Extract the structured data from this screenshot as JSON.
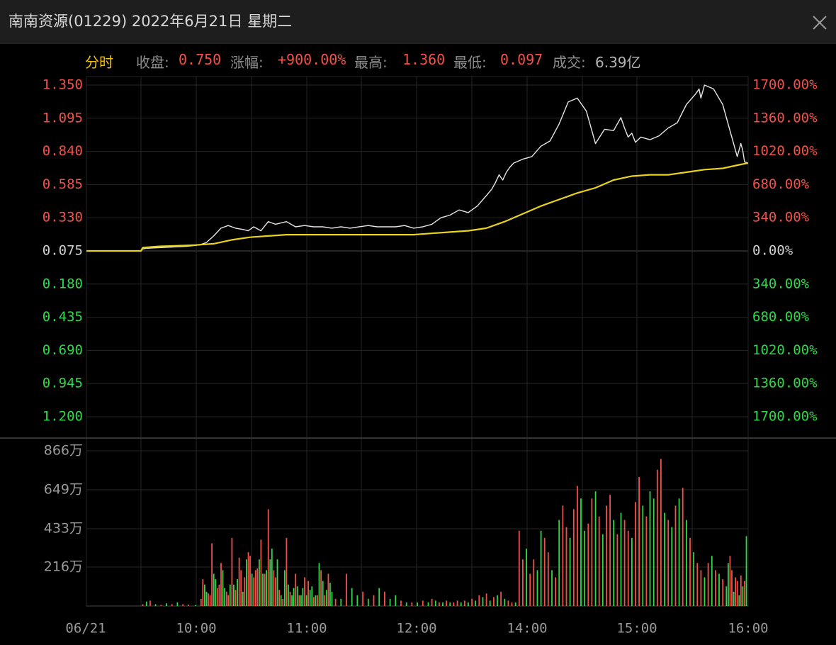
{
  "window": {
    "title": "南南资源(01229) 2022年6月21日 星期二",
    "close_icon": "close-icon"
  },
  "info": {
    "mode_label": "分时",
    "close_label": "收盘:",
    "close_value": "0.750",
    "change_label": "涨幅:",
    "change_value": "+900.00%",
    "high_label": "最高:",
    "high_value": "1.360",
    "low_label": "最低:",
    "low_value": "0.097",
    "volume_label": "成交:",
    "volume_value": "6.39亿"
  },
  "colors": {
    "background": "#000000",
    "grid": "#262626",
    "price_line": "#e6e6e6",
    "avg_line": "#e8d21c",
    "up": "#f0524a",
    "down": "#2fd84a",
    "axis_text": "#9a9a9a",
    "accent": "#f2c100"
  },
  "chart_data": {
    "type": "line",
    "reference_price": 0.075,
    "x_ticks": [
      "06/21",
      "10:00",
      "11:00",
      "12:00",
      "14:00",
      "15:00",
      "16:00"
    ],
    "y_left_ticks_up": [
      "1.350",
      "1.095",
      "0.840",
      "0.585",
      "0.330"
    ],
    "y_left_mid": "0.075",
    "y_left_ticks_down": [
      "0.180",
      "0.435",
      "0.690",
      "0.945",
      "1.200"
    ],
    "y_right_ticks_up": [
      "1700.00%",
      "1360.00%",
      "1020.00%",
      "680.00%",
      "340.00%"
    ],
    "y_right_mid": "0.00%",
    "y_right_ticks_down": [
      "340.00%",
      "680.00%",
      "1020.00%",
      "1360.00%",
      "1700.00%"
    ],
    "ylim_price": [
      0.075,
      1.35
    ],
    "volume_ticks": [
      "866万",
      "649万",
      "433万",
      "216万"
    ],
    "volume_max": 866,
    "series": [
      {
        "x": [
          0,
          15,
          30,
          31,
          33,
          40,
          47,
          55,
          62,
          66,
          70,
          74,
          78,
          82,
          86,
          89,
          92,
          96,
          100,
          104,
          110,
          115,
          120,
          125,
          130,
          135,
          140,
          145,
          150,
          155,
          160,
          165,
          170,
          175,
          180,
          185,
          190,
          195,
          200,
          205,
          210,
          215,
          220,
          223,
          225,
          227,
          229,
          231,
          233,
          235,
          240,
          245,
          250,
          255,
          260,
          265,
          270,
          275,
          280,
          285,
          290,
          294,
          296,
          298,
          300,
          302,
          305,
          310,
          315,
          320,
          325,
          330,
          335,
          336,
          337,
          338,
          340,
          345,
          350,
          355,
          358,
          360,
          361,
          362,
          364
        ],
        "values": [
          0.075,
          0.075,
          0.075,
          0.09,
          0.095,
          0.1,
          0.105,
          0.11,
          0.12,
          0.14,
          0.19,
          0.25,
          0.27,
          0.25,
          0.24,
          0.23,
          0.26,
          0.23,
          0.3,
          0.28,
          0.3,
          0.26,
          0.27,
          0.26,
          0.26,
          0.25,
          0.26,
          0.25,
          0.26,
          0.27,
          0.26,
          0.26,
          0.26,
          0.27,
          0.25,
          0.26,
          0.28,
          0.33,
          0.35,
          0.39,
          0.37,
          0.42,
          0.5,
          0.55,
          0.6,
          0.66,
          0.62,
          0.68,
          0.72,
          0.75,
          0.78,
          0.8,
          0.88,
          0.92,
          1.05,
          1.22,
          1.25,
          1.15,
          0.9,
          1.01,
          1.0,
          1.1,
          1.02,
          0.95,
          0.98,
          0.91,
          0.95,
          0.93,
          0.96,
          1.02,
          1.06,
          1.2,
          1.28,
          1.3,
          1.32,
          1.25,
          1.35,
          1.32,
          1.2,
          0.95,
          0.8,
          0.9,
          0.85,
          0.76,
          0.75
        ]
      },
      {
        "x": [
          0,
          30,
          31,
          40,
          50,
          60,
          70,
          80,
          90,
          100,
          110,
          120,
          130,
          140,
          150,
          160,
          170,
          180,
          190,
          200,
          210,
          220,
          230,
          240,
          250,
          260,
          270,
          280,
          290,
          300,
          310,
          320,
          330,
          340,
          350,
          360,
          364
        ],
        "values": [
          0.075,
          0.075,
          0.1,
          0.11,
          0.115,
          0.12,
          0.13,
          0.16,
          0.18,
          0.19,
          0.2,
          0.2,
          0.2,
          0.2,
          0.2,
          0.2,
          0.2,
          0.2,
          0.21,
          0.22,
          0.23,
          0.25,
          0.3,
          0.36,
          0.42,
          0.47,
          0.52,
          0.56,
          0.62,
          0.65,
          0.66,
          0.66,
          0.68,
          0.7,
          0.71,
          0.74,
          0.75
        ]
      }
    ],
    "volume": {
      "x": [
        31,
        33,
        35,
        38,
        41,
        44,
        47,
        50,
        53,
        56,
        60,
        63,
        64,
        65,
        66,
        67,
        68,
        69,
        70,
        71,
        72,
        73,
        74,
        75,
        76,
        77,
        78,
        79,
        80,
        81,
        82,
        83,
        84,
        85,
        86,
        87,
        88,
        89,
        90,
        91,
        92,
        93,
        94,
        95,
        96,
        97,
        98,
        99,
        100,
        101,
        102,
        103,
        104,
        105,
        106,
        107,
        108,
        109,
        110,
        111,
        112,
        113,
        114,
        115,
        116,
        117,
        118,
        119,
        120,
        121,
        122,
        123,
        124,
        125,
        126,
        127,
        128,
        129,
        130,
        131,
        132,
        133,
        134,
        135,
        137,
        140,
        143,
        146,
        149,
        152,
        155,
        158,
        161,
        164,
        167,
        170,
        173,
        176,
        179,
        182,
        185,
        188,
        190,
        192,
        194,
        196,
        198,
        200,
        202,
        204,
        206,
        208,
        210,
        212,
        214,
        216,
        218,
        220,
        222,
        224,
        226,
        228,
        230,
        232,
        234,
        236,
        238,
        240,
        242,
        244,
        246,
        248,
        250,
        252,
        254,
        256,
        258,
        260,
        262,
        264,
        266,
        268,
        270,
        272,
        274,
        276,
        278,
        280,
        282,
        284,
        286,
        288,
        290,
        292,
        294,
        296,
        298,
        300,
        302,
        304,
        306,
        308,
        310,
        312,
        314,
        316,
        318,
        320,
        322,
        324,
        326,
        328,
        330,
        332,
        334,
        336,
        338,
        340,
        342,
        344,
        346,
        348,
        350,
        352,
        353,
        354,
        355,
        356,
        357,
        358,
        359,
        360,
        361,
        362,
        363
      ],
      "values": [
        10,
        25,
        30,
        10,
        5,
        15,
        10,
        20,
        10,
        8,
        5,
        40,
        150,
        120,
        80,
        70,
        60,
        350,
        180,
        150,
        100,
        120,
        240,
        200,
        100,
        80,
        60,
        120,
        380,
        120,
        90,
        150,
        270,
        200,
        80,
        160,
        260,
        300,
        280,
        180,
        160,
        200,
        210,
        260,
        370,
        180,
        180,
        200,
        540,
        260,
        320,
        200,
        160,
        260,
        90,
        60,
        40,
        200,
        380,
        120,
        80,
        60,
        100,
        180,
        110,
        60,
        60,
        100,
        160,
        60,
        140,
        90,
        110,
        50,
        60,
        60,
        240,
        200,
        140,
        60,
        90,
        180,
        130,
        80,
        40,
        40,
        180,
        100,
        60,
        80,
        40,
        60,
        100,
        80,
        40,
        60,
        30,
        20,
        20,
        20,
        30,
        20,
        40,
        30,
        20,
        20,
        30,
        20,
        20,
        30,
        20,
        30,
        20,
        40,
        30,
        60,
        50,
        70,
        30,
        50,
        60,
        80,
        40,
        30,
        20,
        20,
        420,
        260,
        320,
        180,
        260,
        200,
        420,
        380,
        300,
        200,
        160,
        480,
        560,
        440,
        380,
        540,
        670,
        600,
        420,
        460,
        600,
        640,
        500,
        400,
        560,
        620,
        480,
        400,
        520,
        480,
        420,
        380,
        580,
        720,
        560,
        500,
        640,
        600,
        760,
        820,
        520,
        480,
        440,
        560,
        600,
        660,
        480,
        380,
        300,
        240,
        200,
        160,
        240,
        280,
        200,
        180,
        150,
        110,
        240,
        280,
        200,
        80,
        160,
        140,
        60,
        170,
        110,
        140,
        390,
        280,
        340,
        850,
        490,
        230,
        640,
        400,
        180,
        120,
        200,
        260,
        720,
        160,
        100,
        220,
        520,
        460,
        320,
        680,
        200
      ],
      "up": [
        true,
        false,
        true,
        false,
        true,
        false,
        true,
        false,
        true,
        true,
        false,
        true,
        true,
        false,
        false,
        true,
        true,
        true,
        false,
        false,
        true,
        true,
        true,
        false,
        false,
        true,
        true,
        false,
        true,
        false,
        true,
        false,
        true,
        true,
        false,
        true,
        false,
        true,
        true,
        false,
        true,
        true,
        true,
        false,
        true,
        false,
        true,
        false,
        true,
        false,
        false,
        true,
        true,
        false,
        true,
        false,
        true,
        false,
        true,
        false,
        true,
        false,
        false,
        true,
        false,
        true,
        false,
        false,
        true,
        false,
        true,
        false,
        false,
        true,
        false,
        true,
        false,
        true,
        false,
        true,
        false,
        true,
        false,
        false,
        true,
        false,
        true,
        false,
        false,
        true,
        false,
        true,
        false,
        true,
        false,
        false,
        true,
        false,
        true,
        false,
        true,
        false,
        true,
        false,
        true,
        false,
        true,
        false,
        true,
        true,
        false,
        true,
        false,
        true,
        false,
        true,
        false,
        true,
        false,
        true,
        false,
        true,
        false,
        true,
        true,
        false,
        true,
        true,
        false,
        true,
        true,
        false,
        false,
        true,
        true,
        false,
        true,
        false,
        true,
        true,
        false,
        true,
        true,
        false,
        false,
        true,
        true,
        false,
        true,
        false,
        true,
        true,
        false,
        true,
        false,
        true,
        true,
        false,
        true,
        true,
        false,
        true,
        false,
        false,
        true,
        true,
        false,
        true,
        false,
        true,
        false,
        true,
        false,
        true,
        false,
        true,
        true,
        false,
        true,
        false,
        true,
        false,
        true,
        false,
        false,
        true,
        true,
        false,
        true,
        true,
        false,
        true,
        false,
        true,
        false,
        true,
        false,
        true,
        false,
        true,
        false,
        true,
        false,
        true,
        true,
        false,
        true,
        false,
        true,
        false,
        false,
        true,
        false,
        true,
        false
      ]
    }
  }
}
